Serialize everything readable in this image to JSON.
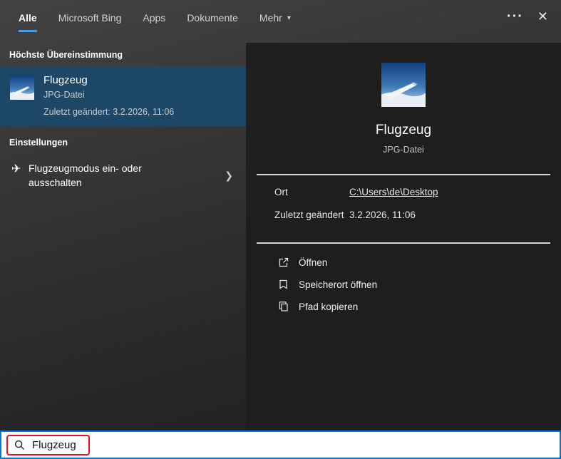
{
  "tabs": {
    "items": [
      {
        "label": "Alle"
      },
      {
        "label": "Microsoft Bing"
      },
      {
        "label": "Apps"
      },
      {
        "label": "Dokumente"
      },
      {
        "label": "Mehr"
      }
    ],
    "dropdown_glyph": "▾"
  },
  "topbar": {
    "more_options": "···",
    "close": "✕"
  },
  "left_panel": {
    "best_match_header": "Höchste Übereinstimmung",
    "best_match": {
      "title": "Flugzeug",
      "file_type": "JPG-Datei",
      "modified": "Zuletzt geändert: 3.2.2026, 11:06"
    },
    "settings_header": "Einstellungen",
    "settings_item": {
      "label": "Flugzeugmodus ein- oder ausschalten",
      "icon_glyph": "✈",
      "chevron": "❯"
    }
  },
  "preview_panel": {
    "title": "Flugzeug",
    "subtitle": "JPG-Datei",
    "fields": [
      {
        "label": "Ort",
        "value": "C:\\Users\\de\\Desktop"
      },
      {
        "label": "Zuletzt geändert",
        "value": "3.2.2026, 11:06"
      }
    ],
    "actions": [
      {
        "label": "Öffnen"
      },
      {
        "label": "Speicherort öffnen"
      },
      {
        "label": "Pfad kopieren"
      }
    ]
  },
  "search_bar": {
    "value": "Flugzeug"
  },
  "colors": {
    "accent_underline": "#4a9edd",
    "selection_background": "#1d4766",
    "search_border": "#0078d7",
    "annotation_red": "#e81123"
  }
}
